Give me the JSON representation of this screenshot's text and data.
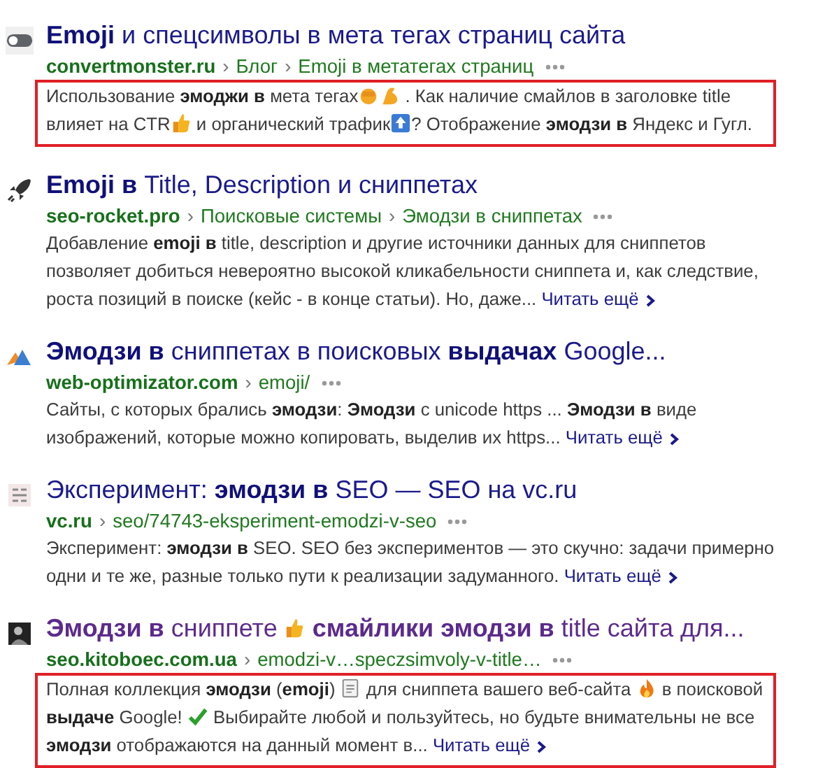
{
  "results": [
    {
      "favicon": {
        "kind": "toggle"
      },
      "visited": false,
      "title": [
        {
          "kind": "text",
          "text": "**Emoji** и спецсимволы в мета тегах страниц сайта"
        }
      ],
      "url": {
        "domain": "convertmonster.ru",
        "separator": "›",
        "path": [
          "Блог",
          "Emoji в метатегах страниц"
        ]
      },
      "highlight": true,
      "snippet": [
        {
          "kind": "text",
          "text": "Использование **эмоджи в** мета тегах"
        },
        {
          "kind": "fist"
        },
        {
          "kind": "flexed"
        },
        {
          "kind": "text",
          "text": " . Как наличие смайлов в заголовке title влияет на CTR"
        },
        {
          "kind": "thumbs"
        },
        {
          "kind": "text",
          "text": " и органический трафик"
        },
        {
          "kind": "top"
        },
        {
          "kind": "text",
          "text": "? Отображение **эмодзи в** Яндекс и Гугл."
        }
      ]
    },
    {
      "favicon": {
        "kind": "rocket"
      },
      "visited": false,
      "title": [
        {
          "kind": "text",
          "text": "**Emoji в** Title, Description и сниппетах"
        }
      ],
      "url": {
        "domain": "seo-rocket.pro",
        "separator": "›",
        "path": [
          "Поисковые системы",
          "Эмодзи в сниппетах"
        ]
      },
      "highlight": false,
      "snippet": [
        {
          "kind": "text",
          "text": "Добавление **emoji в** title, description и другие источники данных для сниппетов позволяет добиться невероятно высокой кликабельности сниппета и, как следствие, роста позиций в поиске (кейс - в конце статьи). Но, даже... "
        }
      ],
      "more_link": "Читать ещё"
    },
    {
      "favicon": {
        "kind": "mountains"
      },
      "visited": false,
      "title": [
        {
          "kind": "text",
          "text": "**Эмодзи в** сниппетах в поисковых **выдачах** Google..."
        }
      ],
      "url": {
        "domain": "web-optimizator.com",
        "separator": "›",
        "path": [
          "emoji/"
        ]
      },
      "highlight": false,
      "snippet": [
        {
          "kind": "text",
          "text": "Сайты, с которых брались **эмодзи**: **Эмодзи** с unicode https ... **Эмодзи в** виде изображений, которые можно копировать, выделив их https... "
        }
      ],
      "more_link": "Читать ещё"
    },
    {
      "favicon": {
        "kind": "grid"
      },
      "visited": false,
      "title": [
        {
          "kind": "text",
          "text": "Эксперимент: **эмодзи в** SEO — SEO на vc.ru"
        }
      ],
      "url": {
        "domain": "vc.ru",
        "separator": "›",
        "path": [
          "seo/74743-eksperiment-emodzi-v-seo"
        ]
      },
      "highlight": false,
      "snippet": [
        {
          "kind": "text",
          "text": "Эксперимент: **эмодзи в** SEO. SEO без экспериментов — это скучно: задачи примерно одни и те же, разные только пути к реализации задуманного. "
        }
      ],
      "more_link": "Читать ещё"
    },
    {
      "favicon": {
        "kind": "photo"
      },
      "visited": true,
      "title": [
        {
          "kind": "text",
          "text": "**Эмодзи в** сниппете "
        },
        {
          "kind": "thumbs"
        },
        {
          "kind": "text",
          "text": " **смайлики эмодзи в** title сайта для..."
        }
      ],
      "url": {
        "domain": "seo.kitoboec.com.ua",
        "separator": "›",
        "path": [
          "emodzi-v…speczsimvoly-v-title…"
        ]
      },
      "highlight": true,
      "snippet": [
        {
          "kind": "text",
          "text": "Полная коллекция **эмодзи** (**emoji**) "
        },
        {
          "kind": "clipboard"
        },
        {
          "kind": "text",
          "text": " для сниппета вашего веб-сайта "
        },
        {
          "kind": "fire"
        },
        {
          "kind": "text",
          "text": " в поисковой **выдаче** Google! "
        },
        {
          "kind": "check"
        },
        {
          "kind": "text",
          "text": " Выбирайте любой и пользуйтесь, но будьте внимательны не все **эмодзи** отображаются на данный момент в... "
        }
      ],
      "more_link": "Читать ещё"
    }
  ]
}
